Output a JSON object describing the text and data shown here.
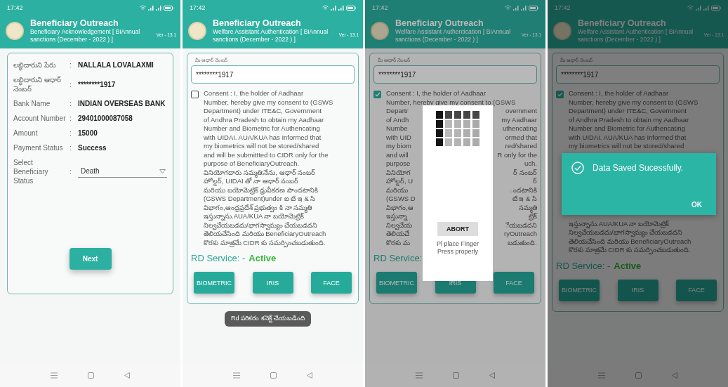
{
  "screens": [
    {
      "kind": "acknowledgement",
      "status_bar": {
        "time": "17:42"
      },
      "header": {
        "title": "Beneficiary Outreach",
        "subtitle": "Beneficiary Acknowledgement [ BiAnnual sanctions (December - 2022 ) ]",
        "version": "Ver - 13.1"
      },
      "fields": [
        {
          "kind": "text",
          "label": "లబ్ధిదారుని పేరు",
          "separator": ":",
          "value": "NALLALA LOVALAXMI"
        },
        {
          "kind": "text",
          "label": "లబ్ధిదారుని ఆధార్ నెంబర్",
          "separator": ":",
          "value": "********1917"
        },
        {
          "kind": "text",
          "label": "Bank Name",
          "separator": ":",
          "value": "INDIAN OVERSEAS BANK"
        },
        {
          "kind": "text",
          "label": "Account Number",
          "separator": ":",
          "value": "29401000087058"
        },
        {
          "kind": "text",
          "label": "Amount",
          "separator": ":",
          "value": "15000"
        },
        {
          "kind": "text",
          "label": "Payment Status",
          "separator": ":",
          "value": "Success"
        },
        {
          "kind": "dropdown",
          "label": "Select Beneficiary Status",
          "separator": ":",
          "value": "Death"
        }
      ],
      "next_button": "Next"
    },
    {
      "kind": "authentication",
      "status_bar": {
        "time": "17:42"
      },
      "header": {
        "title": "Beneficiary Outreach",
        "subtitle": "Welfare Assistant Authentication [ BiAnnual sanctions (December - 2022 ) ]",
        "version": "Ver - 13.1"
      },
      "aadhaar_field": {
        "label": "మీ ఆధార్ నెంబర్",
        "value": "********1917"
      },
      "consent": {
        "checked": false,
        "lines": [
          "Consent : I, the holder of Aadhaar",
          "Number, hereby give my consent to (GSWS",
          "Department) under ITE&C, Government",
          "of Andhra Pradesh to obtain my Aadhaar",
          "Number and Biometric for Authencating",
          "with UIDAI. AUA/KUA has Informed that",
          "my biometrics will not be stored/shared",
          "and will be submittted to CIDR only for the",
          "purpose of BeneficiaryOutreach.",
          "వినియోగదారు సమ్మతి:నేను, ఆధార్ నంబర్",
          "హోల్డర్, UIDAI తో నా ఆధార్ నంబర్",
          "మరియు బయోమెట్రిక్ ధ్రువీకరణ పొందటానికి",
          "(GSWS Department)under ఐ టి ఇ & సి",
          "విభాగం,ఆంధ్రప్రదేశ్ ప్రభుత్వం కి నా సమ్మతి",
          "ఇస్తున్నాను.AUA/KUA నా బయోమెట్రిక్",
          "నిల్వచేయబడదు/భాగస్వామ్యం చేయబడదని",
          "తెలియచేసింది మరియు BeneficiaryOutreach",
          "కొరకు మాత్రమే CIDR కు సమర్పించబడుతుంది."
        ]
      },
      "rd_service": {
        "label": "RD Service: -",
        "status": "Active"
      },
      "buttons": [
        "BIOMETRIC",
        "IRIS",
        "FACE"
      ],
      "toast": "Rd పరికరం కనెక్ట్ చేయబడింది"
    },
    {
      "kind": "authentication",
      "status_bar": {
        "time": "17:42"
      },
      "header": {
        "title": "Beneficiary Outreach",
        "subtitle": "Welfare Assistant Authentication [ BiAnnual sanctions (December - 2022 ) ]",
        "version": "Ver - 13.1"
      },
      "aadhaar_field": {
        "label": "మీ ఆధార్ నెంబర్",
        "value": "********1917"
      },
      "consent": {
        "checked": true,
        "lines": [
          "Consent : I, the holder of Aadhaar",
          "Number, hereby give my consent to (GSWS",
          {
            "left": "Departr",
            "right": "overnment"
          },
          {
            "left": "of Andh",
            "right": "my Aadhaar"
          },
          {
            "left": "Numbe",
            "right": "uthencating"
          },
          {
            "left": "with UID",
            "right": "ormed that"
          },
          {
            "left": "my biom",
            "right": "red/shared"
          },
          {
            "left": "and will",
            "right": "R only for the"
          },
          {
            "left": "purpose",
            "right": "uch."
          },
          {
            "left": "వినియోగ",
            "right": "ర్ నంబర్"
          },
          {
            "left": "హోల్డర్, U",
            "right": "ర్"
          },
          {
            "left": "మరియు",
            "right": "ందటానికి"
          },
          {
            "left": "(GSWS D",
            "right": "టి ఇ & సి"
          },
          {
            "left": "విభాగం,ఆ",
            "right": "సమ్మతి"
          },
          {
            "left": "ఇస్తున్నా",
            "right": "ట్రిక్"
          },
          {
            "left": "నిల్వచేయ",
            "right": "ేయబడదని"
          },
          {
            "left": "తెలియచే",
            "right": "ryOutreach"
          },
          {
            "left": "కొరకు మ",
            "right": "బడుతుంది."
          }
        ],
        "dialog": {
          "kind": "fingerprint",
          "button": "ABORT",
          "message": "Pl place Finger Press properly"
        }
      },
      "rd_service": {
        "label": "RD Service:"
      },
      "buttons": [
        "BIOMETRIC",
        "IRIS",
        "FACE"
      ]
    },
    {
      "kind": "authentication",
      "status_bar": {
        "time": "17:42"
      },
      "header": {
        "title": "Beneficiary Outreach",
        "subtitle": "Welfare Assistant Authentication [ BiAnnual sanctions (December - 2022 ) ]",
        "version": "Ver - 13.1"
      },
      "aadhaar_field": {
        "label": "మీ ఆధార్ నెంబర్",
        "value": "********1917"
      },
      "consent": {
        "checked": true,
        "lines": [
          "Consent : I, the holder of Aadhaar",
          "Number, hereby give my consent to (GSWS",
          "Department) under ITE&C, Government",
          "of Andhra Pradesh to obtain my Aadhaar",
          "Number and Biometric for Authencating",
          "with UIDAI. AUA/KUA has Informed that",
          "my biometrics will not be stored/shared"
        ],
        "dialog": {
          "kind": "success",
          "message": "Data Saved Sucessfully.",
          "button": "OK"
        },
        "lines_after_dialog": [
          "ఇస్తున్నాను.AUA/KUA నా బయోమెట్రిక్",
          "నిల్వచేయబడదు/భాగస్వామ్యం చేయబడదని",
          "తెలియచేసింది మరియు BeneficiaryOutreach",
          "కొరకు మాత్రమే CIDR కు సమర్పించబడుతుంది."
        ]
      },
      "rd_service": {
        "label": "RD Service: -",
        "status": "Active"
      },
      "buttons": [
        "BIOMETRIC",
        "IRIS",
        "FACE"
      ]
    }
  ]
}
